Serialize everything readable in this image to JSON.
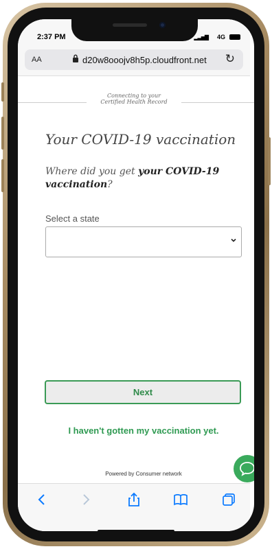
{
  "status": {
    "time": "2:37 PM",
    "network": "4G"
  },
  "address_bar": {
    "text_size_label": "AA",
    "url": "d20w8ooojv8h5p.cloudfront.net"
  },
  "header": {
    "line1": "Connecting to your",
    "line2": "Certified Health Record"
  },
  "page": {
    "title": "Your COVID-19 vaccination",
    "question_prefix": "Where did you get ",
    "question_bold": "your COVID-19 vaccination",
    "question_suffix": "?",
    "state_label": "Select a state",
    "state_value": ""
  },
  "actions": {
    "next_label": "Next",
    "not_yet_label": "I haven't gotten my vaccination yet."
  },
  "footer": {
    "powered_by": "Powered by Consumer network"
  },
  "icons": {
    "back": "chevron-left-icon",
    "forward": "chevron-right-icon",
    "share": "share-icon",
    "bookmarks": "book-icon",
    "tabs": "tabs-icon",
    "chat": "chat-bubble-icon",
    "lock": "lock-icon",
    "reload": "reload-icon"
  },
  "colors": {
    "accent_green": "#2f9a52",
    "ios_blue": "#0a7aff"
  }
}
